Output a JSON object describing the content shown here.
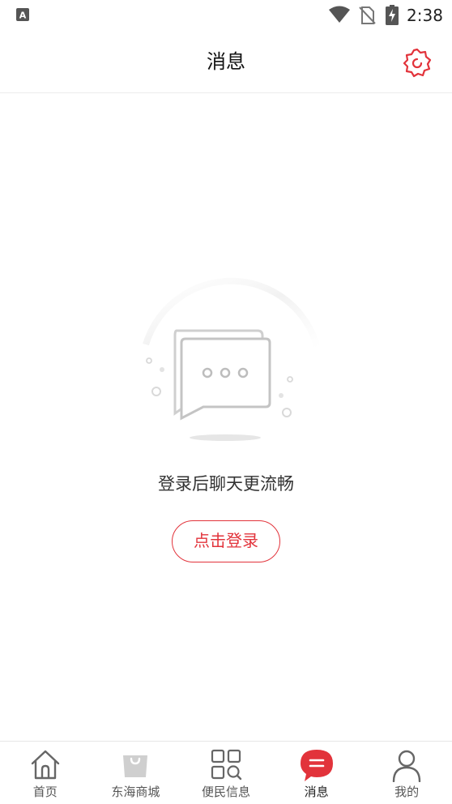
{
  "status_bar": {
    "time": "2:38",
    "icons": [
      "input-method-icon",
      "wifi-icon",
      "no-sim-icon",
      "battery-charging-icon"
    ]
  },
  "header": {
    "title": "消息",
    "settings_icon": "settings-gear-icon"
  },
  "empty_state": {
    "illustration": "chat-bubbles-icon",
    "message": "登录后聊天更流畅",
    "login_button_label": "点击登录"
  },
  "bottom_nav": {
    "active_color": "#e2333b",
    "items": [
      {
        "label": "首页",
        "icon": "home-icon",
        "active": false
      },
      {
        "label": "东海商城",
        "icon": "shopping-bag-icon",
        "active": false
      },
      {
        "label": "便民信息",
        "icon": "grid-search-icon",
        "active": false
      },
      {
        "label": "消息",
        "icon": "message-bubble-icon",
        "active": true
      },
      {
        "label": "我的",
        "icon": "user-icon",
        "active": false
      }
    ]
  },
  "colors": {
    "accent": "#e2333b",
    "text": "#333333",
    "divider": "#ececec"
  }
}
